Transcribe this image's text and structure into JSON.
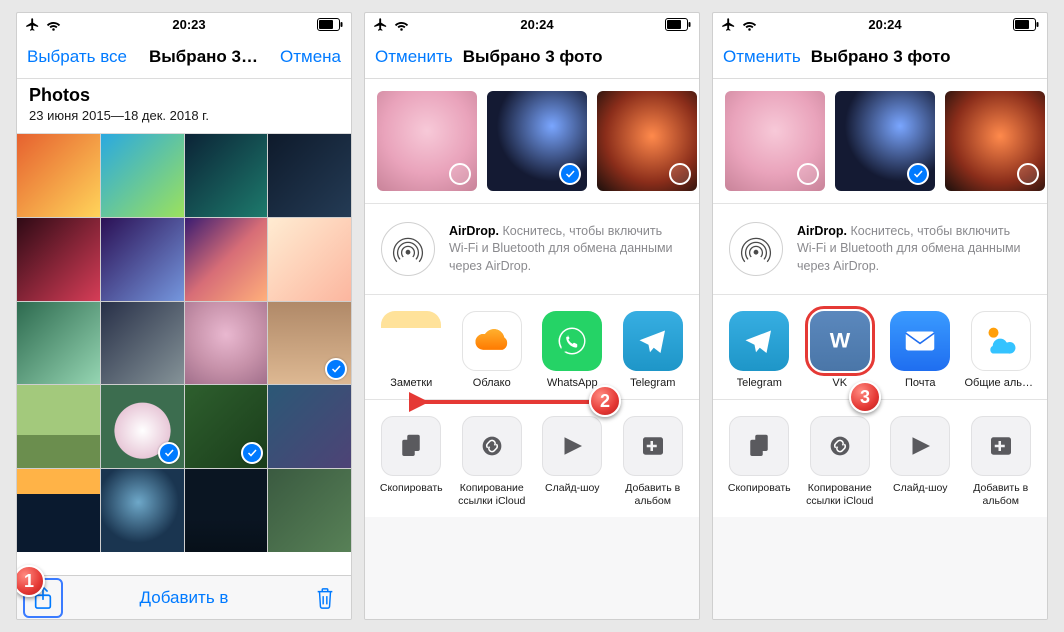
{
  "screen1": {
    "status_time": "20:23",
    "nav": {
      "select_all": "Выбрать все",
      "title": "Выбрано 3…",
      "cancel": "Отмена"
    },
    "section": {
      "title": "Photos",
      "subtitle": "23 июня 2015—18 дек. 2018 г."
    },
    "thumbs": [
      {
        "name": "photo-01",
        "bg": "linear-gradient(135deg,#e6612f,#ffd45a)"
      },
      {
        "name": "photo-02",
        "bg": "linear-gradient(135deg,#2aa9e0,#9be15d)"
      },
      {
        "name": "photo-03",
        "bg": "linear-gradient(135deg,#0b2336,#1d7a6c)"
      },
      {
        "name": "photo-04",
        "bg": "linear-gradient(135deg,#0e1a2b,#243b55)"
      },
      {
        "name": "photo-05",
        "bg": "linear-gradient(135deg,#2f0a15,#d63d57)"
      },
      {
        "name": "photo-06",
        "bg": "linear-gradient(135deg,#2b1055,#7597de)"
      },
      {
        "name": "photo-07",
        "bg": "linear-gradient(135deg,#3a1c71,#d76d77,#ffaf7b)"
      },
      {
        "name": "photo-08",
        "bg": "linear-gradient(135deg,#ffecd2,#fcb69f)"
      },
      {
        "name": "photo-09",
        "bg": "linear-gradient(135deg,#2d6a4f,#95d5b2)"
      },
      {
        "name": "photo-10",
        "bg": "linear-gradient(135deg,#283048,#859398)"
      },
      {
        "name": "photo-11",
        "bg": "radial-gradient(circle at 50% 40%,#e9b8d0,#c691a9 55%,#a16f8b)"
      },
      {
        "name": "photo-12",
        "bg": "linear-gradient(180deg,#b08968,#ddb892)",
        "checked": true
      },
      {
        "name": "photo-13",
        "bg": "linear-gradient(0deg,#6b8e4e 40%,#a3c97c 40%)"
      },
      {
        "name": "photo-14",
        "bg": "radial-gradient(circle at 50% 55%,#fff,#e8c8d8 45%,#3c6d4f 46%)",
        "checked": true
      },
      {
        "name": "photo-15",
        "bg": "linear-gradient(135deg,#2e5f2e,#1a3d1a)",
        "checked": true
      },
      {
        "name": "photo-16",
        "bg": "linear-gradient(135deg,#2b5876,#4e4376)"
      },
      {
        "name": "photo-17",
        "bg": "linear-gradient(180deg,#ffb347 30%,#0a1a2f 30%)"
      },
      {
        "name": "photo-18",
        "bg": "radial-gradient(circle at 45% 40%,#6ea8c9,#1a3550 60%)"
      },
      {
        "name": "photo-19",
        "bg": "linear-gradient(180deg,#0a1522 60%,#071019)"
      },
      {
        "name": "photo-20",
        "bg": "linear-gradient(135deg,#3a5a40,#588157)"
      }
    ],
    "add_to": "Добавить в",
    "badge": "1"
  },
  "share_common": {
    "status_time": "20:24",
    "cancel": "Отменить",
    "title": "Выбрано 3 фото",
    "airdrop_bold": "AirDrop.",
    "airdrop_rest": " Коснитесь, чтобы включить Wi-Fi и Bluetooth для обмена данными через AirDrop.",
    "actions": [
      {
        "name": "action-copy",
        "label": "Скопировать"
      },
      {
        "name": "action-copy-icloud",
        "label": "Копирование ссылки iCloud"
      },
      {
        "name": "action-slideshow",
        "label": "Слайд-шоу"
      },
      {
        "name": "action-add-album",
        "label": "Добавить в альбом"
      }
    ]
  },
  "screen2": {
    "thumbs": [
      {
        "name": "share-thumb-1",
        "bg": "radial-gradient(circle at 50% 40%,#f7c9d8,#e9a3bb 55%,#c88399)",
        "sel": false
      },
      {
        "name": "share-thumb-2",
        "bg": "radial-gradient(circle at 65% 35%,#7aa6ff,#141a33 60%)",
        "sel": true
      },
      {
        "name": "share-thumb-3",
        "bg": "radial-gradient(circle at 55% 45%,#ff8a4c,#8a2d1a 60%,#1a0f0c)",
        "sel": false
      }
    ],
    "apps": [
      {
        "name": "app-notes",
        "label": "Заметки",
        "bg": "linear-gradient(180deg,#ffe29a 28%,#fff 28%)"
      },
      {
        "name": "app-cloud",
        "label": "Облако",
        "bg": "#ffffff"
      },
      {
        "name": "app-whatsapp",
        "label": "WhatsApp",
        "bg": "#25d366"
      },
      {
        "name": "app-telegram",
        "label": "Telegram",
        "bg": "linear-gradient(180deg,#37aee2,#1e96c8)"
      }
    ],
    "badge": "2"
  },
  "screen3": {
    "thumbs": [
      {
        "name": "share-thumb-1",
        "bg": "radial-gradient(circle at 50% 40%,#f7c9d8,#e9a3bb 55%,#c88399)",
        "sel": false
      },
      {
        "name": "share-thumb-2",
        "bg": "radial-gradient(circle at 65% 35%,#7aa6ff,#141a33 60%)",
        "sel": true
      },
      {
        "name": "share-thumb-3",
        "bg": "radial-gradient(circle at 55% 45%,#ff8a4c,#8a2d1a 60%,#1a0f0c)",
        "sel": false
      }
    ],
    "apps": [
      {
        "name": "app-telegram",
        "label": "Telegram",
        "bg": "linear-gradient(180deg,#37aee2,#1e96c8)"
      },
      {
        "name": "app-vk",
        "label": "VK",
        "bg": "linear-gradient(180deg,#5b88bd,#4a76a8)",
        "hi": true
      },
      {
        "name": "app-mail",
        "label": "Почта",
        "bg": "linear-gradient(180deg,#3a9bff,#1f6ef0)"
      },
      {
        "name": "app-shared-albums",
        "label": "Общие альбомы",
        "bg": "#ffffff"
      }
    ],
    "badge": "3"
  }
}
